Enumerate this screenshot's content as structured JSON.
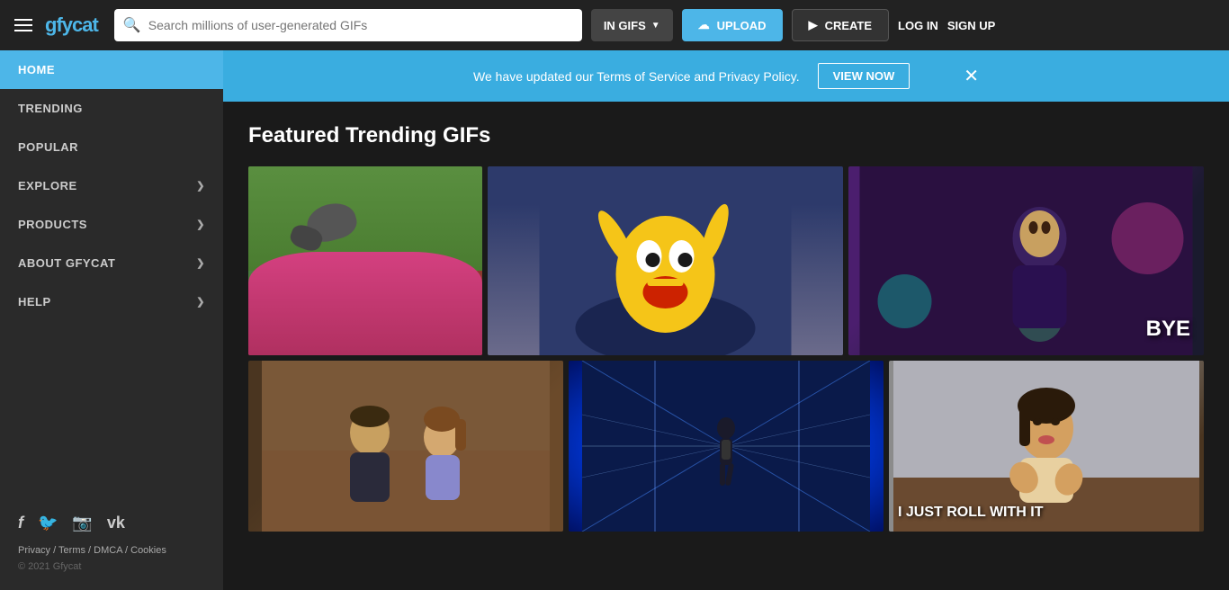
{
  "topnav": {
    "logo": "gfycat",
    "search_placeholder": "Search millions of user-generated GIFs",
    "search_type_label": "IN GIFS",
    "upload_label": "UPLOAD",
    "create_label": "CREATE",
    "login_label": "LOG IN",
    "signup_label": "SIGN UP"
  },
  "sidebar": {
    "items": [
      {
        "label": "HOME",
        "active": true,
        "has_chevron": false
      },
      {
        "label": "TRENDING",
        "active": false,
        "has_chevron": false
      },
      {
        "label": "POPULAR",
        "active": false,
        "has_chevron": false
      },
      {
        "label": "EXPLORE",
        "active": false,
        "has_chevron": true
      },
      {
        "label": "PRODUCTS",
        "active": false,
        "has_chevron": true
      },
      {
        "label": "ABOUT GFYCAT",
        "active": false,
        "has_chevron": true
      },
      {
        "label": "HELP",
        "active": false,
        "has_chevron": true
      }
    ],
    "social": {
      "icons": [
        "f",
        "t",
        "ig",
        "vk"
      ]
    },
    "footer_links": [
      "Privacy",
      "Terms",
      "DMCA",
      "Cookies"
    ],
    "copyright": "© 2021 Gfycat"
  },
  "banner": {
    "text": "We have updated our Terms of Service and Privacy Policy.",
    "button_label": "VIEW NOW"
  },
  "main": {
    "section_title": "Featured Trending GIFs",
    "gifs": {
      "top": [
        {
          "id": "dog",
          "overlay_text": ""
        },
        {
          "id": "cartoon",
          "overlay_text": ""
        },
        {
          "id": "loki",
          "overlay_text": "BYE"
        }
      ],
      "bottom": [
        {
          "id": "friends",
          "overlay_text": ""
        },
        {
          "id": "dance",
          "overlay_text": ""
        },
        {
          "id": "kim",
          "overlay_text": "I JUST ROLL WITH IT"
        }
      ]
    }
  }
}
